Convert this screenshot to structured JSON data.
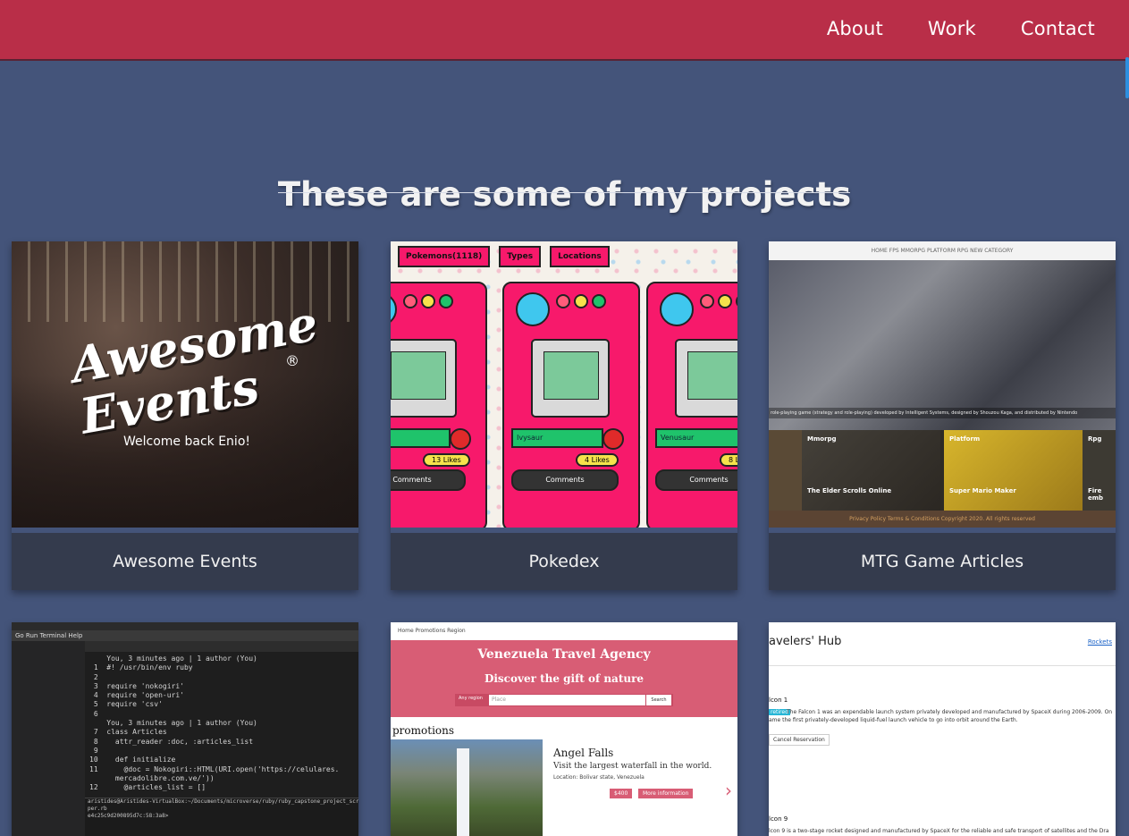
{
  "nav": {
    "about": "About",
    "work": "Work",
    "contact": "Contact"
  },
  "section": {
    "heading": "These are some of my projects"
  },
  "projects": [
    {
      "title": "Awesome Events",
      "logo_text": "Awesome Events",
      "welcome": "Welcome back  Enio!"
    },
    {
      "title": "Pokedex",
      "tabs": [
        "Pokemons(1118)",
        "Types",
        "Locations"
      ],
      "names": [
        "asaur",
        "Ivysaur",
        "Venusaur"
      ],
      "likes": [
        "13 Likes",
        "4 Likes",
        "8 L"
      ],
      "comments": "Comments"
    },
    {
      "title": "MTG Game Articles",
      "menu": "HOME   FPS   MMORPG   PLATFORM   RPG   NEW CATEGORY",
      "strip": "role-playing game (strategy and role-playing) developed by Intelligent Systems, designed by Shouzou Kaga, and distributed by Nintendo",
      "categories": [
        "Mmorpg",
        "Platform",
        "Rpg"
      ],
      "articles": [
        "The Elder Scrolls Online",
        "Super Mario Maker",
        "Fire emb"
      ],
      "footer": "Privacy Policy  Terms & Conditions  Copyright 2020. All rights reserved"
    },
    {
      "menu": "Go  Run  Terminal  Help",
      "code": "    You, 3 minutes ago | 1 author (You)\n 1  #! /usr/bin/env ruby\n 2\n 3  require 'nokogiri'\n 4  require 'open-uri'\n 5  require 'csv'\n 6\n    You, 3 minutes ago | 1 author (You)\n 7  class Articles\n 8    attr_reader :doc, :articles_list\n 9\n10    def initialize\n11      @doc = Nokogiri::HTML(URI.open('https://celulares.\n      mercadolibre.com.ve/'))\n12      @articles_list = []",
      "terminal": "aristides@Aristides-VirtualBox:~/Documents/microverse/ruby/ruby_capstone_project_scraper$\nper.rb\ne4c25c9d200895d7c:58:3a8>"
    },
    {
      "links": "Home   Promotions   Region",
      "title": "Venezuela Travel Agency",
      "subtitle": "Discover the gift of nature",
      "region": "Any region",
      "placeholder": "Place",
      "search": "Search",
      "promotions": "promotions",
      "place": "Angel Falls",
      "desc": "Visit the largest waterfall in the world.",
      "location": "Location: Bolivar state, Venezuela",
      "price": "$400",
      "more": "More information"
    },
    {
      "brand": "avelers' Hub",
      "link": "Rockets",
      "r1": "lcon 1",
      "tag": "retired",
      "p1": "The Falcon 1 was an expendable launch system privately developed and manufactured by SpaceX during 2006-2009. On",
      "p2": "ame the first privately-developed liquid-fuel launch vehicle to go into orbit around the Earth.",
      "button": "Cancel Reservation",
      "r2": "lcon 9",
      "p3": "lcon 9 is a two-stage rocket designed and manufactured by SpaceX for the reliable and safe transport of satellites and the Dra"
    }
  ]
}
